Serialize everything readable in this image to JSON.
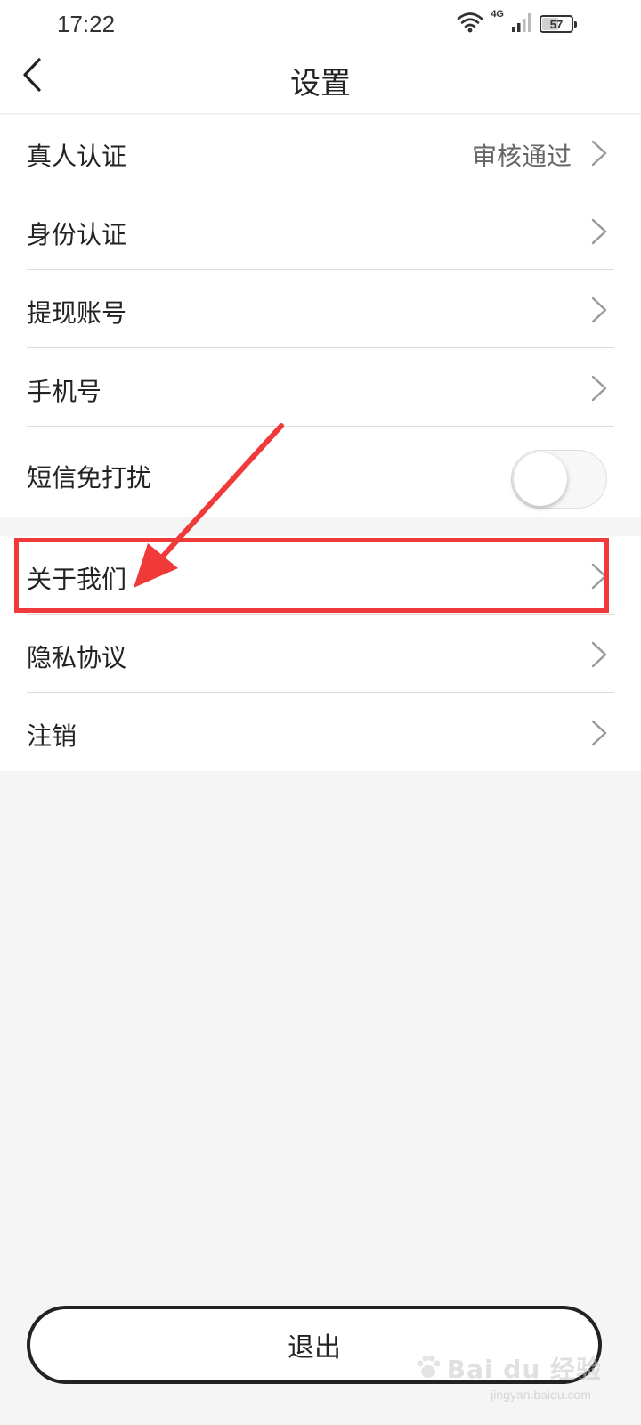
{
  "status_bar": {
    "time": "17:22",
    "network_label": "4G",
    "battery_level": "57",
    "wifi_icon": "wifi-icon",
    "signal_icon": "cellular-signal-icon",
    "battery_icon": "battery-icon"
  },
  "header": {
    "title": "设置",
    "back_icon": "chevron-left-icon"
  },
  "settings_group_1": {
    "items": [
      {
        "label": "真人认证",
        "value": "审核通过",
        "control": "chevron"
      },
      {
        "label": "身份认证",
        "value": "",
        "control": "chevron"
      },
      {
        "label": "提现账号",
        "value": "",
        "control": "chevron"
      },
      {
        "label": "手机号",
        "value": "",
        "control": "chevron"
      },
      {
        "label": "短信免打扰",
        "control": "toggle",
        "toggle_on": false
      }
    ]
  },
  "settings_group_2": {
    "items": [
      {
        "label": "关于我们",
        "control": "chevron"
      },
      {
        "label": "隐私协议",
        "control": "chevron"
      },
      {
        "label": "注销",
        "control": "chevron"
      }
    ]
  },
  "annotation": {
    "highlight_color": "#f03a3a",
    "highlighted_item": "关于我们"
  },
  "footer": {
    "logout_label": "退出"
  },
  "watermark": {
    "brand": "Bai du 经验",
    "url": "jingyan.baidu.com"
  },
  "colors": {
    "page_background": "#f5f5f5",
    "card_background": "#ffffff",
    "text_primary": "#222222",
    "text_secondary": "#666666",
    "divider": "#dcdcdc",
    "chevron": "#999999"
  }
}
